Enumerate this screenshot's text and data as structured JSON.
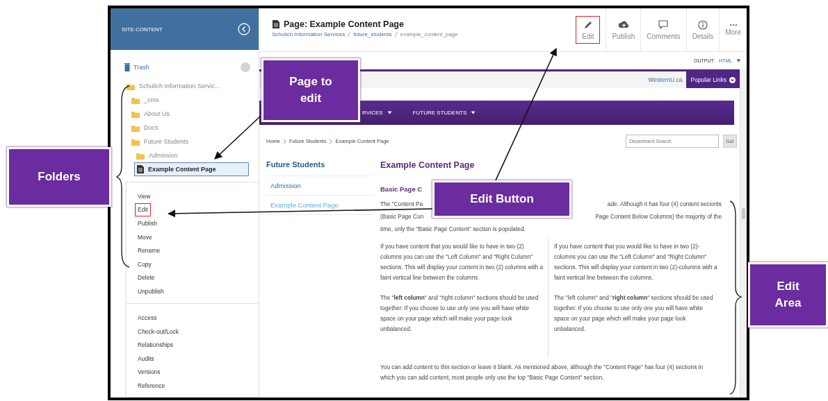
{
  "sidebar": {
    "header": "SITE CONTENT",
    "trash": {
      "label": "Trash"
    },
    "tree": [
      {
        "label": "Schulich Information Servic...",
        "kind": "folder",
        "selected": false,
        "children": [
          {
            "label": "_cms",
            "kind": "folder",
            "selected": false
          },
          {
            "label": "About Us",
            "kind": "folder",
            "selected": false
          },
          {
            "label": "Docs",
            "kind": "folder",
            "selected": false
          },
          {
            "label": "Future Students",
            "kind": "folder",
            "selected": false,
            "children": [
              {
                "label": "Admission",
                "kind": "folder",
                "selected": false
              },
              {
                "label": "Example Content Page",
                "kind": "page",
                "selected": true
              }
            ]
          }
        ]
      }
    ],
    "context_menu": [
      [
        {
          "label": "View",
          "highlighted": false
        },
        {
          "label": "Edit",
          "highlighted": true
        },
        {
          "label": "Publish",
          "highlighted": false
        },
        {
          "label": "Move",
          "highlighted": false
        },
        {
          "label": "Rename",
          "highlighted": false
        },
        {
          "label": "Copy",
          "highlighted": false
        },
        {
          "label": "Delete",
          "highlighted": false
        },
        {
          "label": "Unpublish",
          "highlighted": false
        }
      ],
      [
        {
          "label": "Access",
          "highlighted": false
        },
        {
          "label": "Check-out/Lock",
          "highlighted": false
        },
        {
          "label": "Relationships",
          "highlighted": false
        },
        {
          "label": "Audits",
          "highlighted": false
        },
        {
          "label": "Versions",
          "highlighted": false
        },
        {
          "label": "Reference",
          "highlighted": false
        }
      ]
    ]
  },
  "page_header": {
    "title": "Page: Example Content Page",
    "breadcrumb": [
      {
        "label": "Schulich Information Services",
        "kind": "link"
      },
      {
        "label": "future_students",
        "kind": "link"
      },
      {
        "label": "example_content_page",
        "kind": "current"
      }
    ]
  },
  "toolbar": [
    {
      "label": "Edit",
      "kind": "pencil",
      "highlighted": true
    },
    {
      "label": "Publish",
      "kind": "cloud",
      "highlighted": false
    },
    {
      "label": "Comments",
      "kind": "comment",
      "highlighted": false
    },
    {
      "label": "Details",
      "kind": "info",
      "highlighted": false
    },
    {
      "label": "More",
      "kind": "more",
      "highlighted": false
    }
  ],
  "output": {
    "label": "OUTPUT:",
    "value": "HTML"
  },
  "preview": {
    "site_link": "WesternU.ca",
    "popular_links": "Popular Links",
    "nav": [
      "RVICES",
      "FUTURE STUDENTS"
    ],
    "breadcrumb": [
      "Home",
      "Future Students",
      "Example Content Page"
    ],
    "search": {
      "placeholder": "Department Search",
      "button": "Go!"
    },
    "side_nav": {
      "title": "Future Students",
      "items": [
        {
          "label": "Admission",
          "selected": false
        },
        {
          "label": "Example Content Page",
          "selected": true
        }
      ]
    },
    "heading": "Example Content Page",
    "subheading": "Basic Page C",
    "intro_lines": [
      [
        "The \"Content Pa",
        "ade.  Although it has four (4) content secionts"
      ],
      [
        "(Basic Page Con",
        "Page Content Below Columns) the majority of the"
      ],
      [
        "time, only the \"Basic Page Content\" section is populated."
      ]
    ],
    "columns": [
      [
        "If you have content that you would like to have in two (2) columns you can use the \"Left Column\" and \"Right Column\" sections.  This will display your content in two (2) columns with a faint vertical line between the columns.",
        "The \"**left column**\" and \"right column\" sections should be used together.  If you choose to use only one you will have white space on your page which will make your page look unbalanced."
      ],
      [
        "If you have content that you would like to have in two (2)-columns you can use the \"Left Column\" and \"Right Column\" sections.  This will display your content in two (2)-columns with a faint vertical line between the columns.",
        "The \"left column\" and \"**right column**\" sections should be used together.  If you choose to use only one you will have white space on your page which will make your page look unbalanced."
      ]
    ],
    "closing": "You can add content to this section or leave it blank.  As mentioned above, although the \"Content Page\" has four (4) sections in which you can add content, most people only use the top \"Basic Page Content\" section."
  },
  "callouts": [
    {
      "text": "Folders"
    },
    {
      "text": "Page to edit"
    },
    {
      "text": "Edit Button"
    },
    {
      "text": "Edit Area"
    }
  ]
}
